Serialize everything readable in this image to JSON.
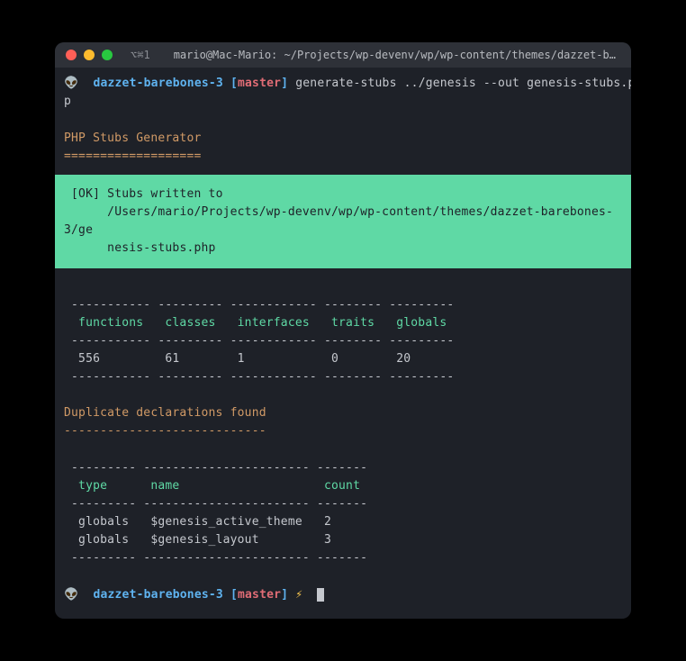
{
  "titlebar": {
    "shortcut": "⌥⌘1",
    "title": "mario@Mac-Mario: ~/Projects/wp-devenv/wp/wp-content/themes/dazzet-barebones..."
  },
  "prompt1": {
    "icon": "👽",
    "dir": "dazzet-barebones-3",
    "branch_open": "[",
    "branch": "master",
    "branch_close": "]",
    "command": "generate-stubs ../genesis --out genesis-stubs.ph",
    "command_wrap": "p"
  },
  "section1": {
    "title": "PHP Stubs Generator",
    "underline": "==================="
  },
  "ok_box": {
    "line1": " [OK] Stubs written to",
    "line2": "      /Users/mario/Projects/wp-devenv/wp/wp-content/themes/dazzet-barebones-3/ge",
    "line3": "      nesis-stubs.php"
  },
  "stats_table": {
    "border_top": " ----------- --------- ------------ -------- ---------",
    "header": "  functions   classes   interfaces   traits   globals",
    "border_mid": " ----------- --------- ------------ -------- ---------",
    "row": "  556         61        1            0        20",
    "border_bot": " ----------- --------- ------------ -------- ---------"
  },
  "section2": {
    "title": "Duplicate declarations found",
    "underline": "----------------------------"
  },
  "dupes_table": {
    "border_top": " --------- ----------------------- -------",
    "header": "  type      name                    count",
    "border_mid": " --------- ----------------------- -------",
    "row1": "  globals   $genesis_active_theme   2",
    "row2": "  globals   $genesis_layout         3",
    "border_bot": " --------- ----------------------- -------"
  },
  "prompt2": {
    "icon": "👽",
    "dir": "dazzet-barebones-3",
    "branch_open": "[",
    "branch": "master",
    "branch_close": "]",
    "lightning": "⚡"
  }
}
